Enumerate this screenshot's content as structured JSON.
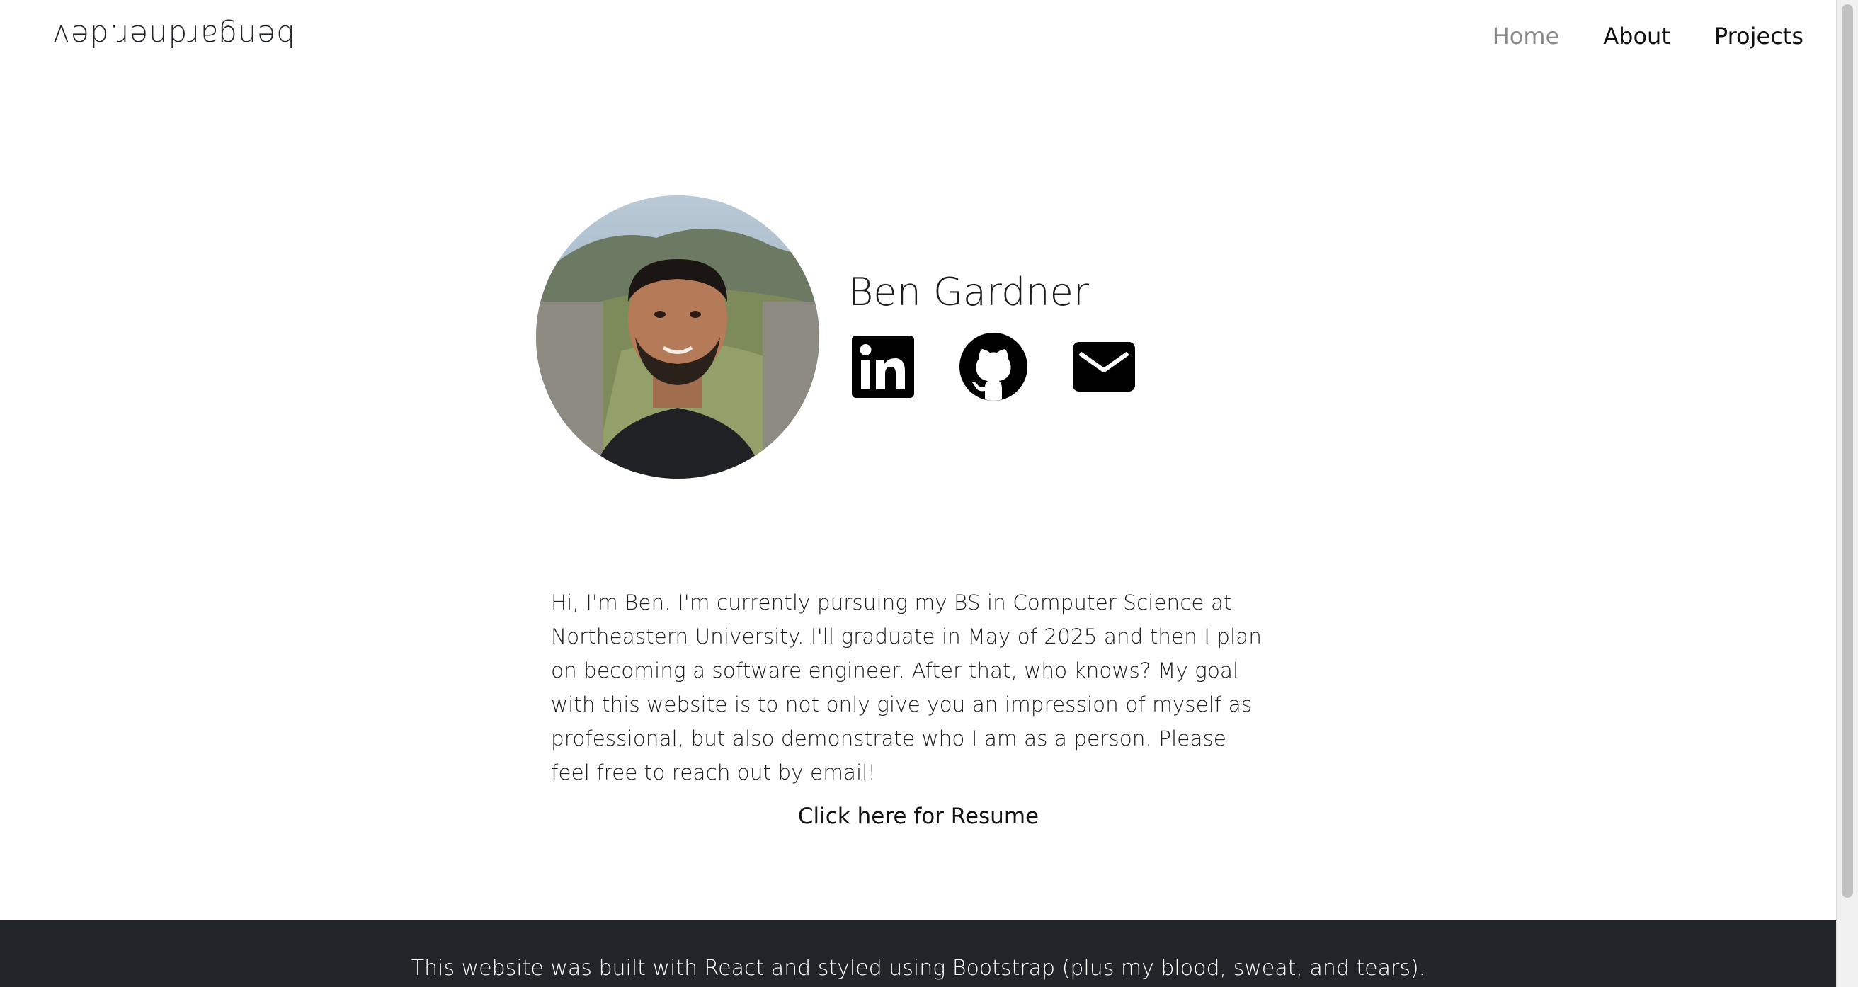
{
  "brand": {
    "text": "bengardner.dev"
  },
  "nav": {
    "items": [
      {
        "label": "Home",
        "active": true
      },
      {
        "label": "About",
        "active": false
      },
      {
        "label": "Projects",
        "active": false
      }
    ]
  },
  "profile": {
    "name": "Ben Gardner",
    "social": [
      {
        "icon": "linkedin-icon"
      },
      {
        "icon": "github-icon"
      },
      {
        "icon": "mail-icon"
      }
    ]
  },
  "bio": {
    "text": "Hi, I'm Ben. I'm currently pursuing my BS in Computer Science at Northeastern University. I'll graduate in May of 2025 and then I plan on becoming a software engineer. After that, who knows? My goal with this website is to not only give you an impression of myself as professional, but also demonstrate who I am as a person. Please feel free to reach out by email!"
  },
  "resume": {
    "label": "Click here for Resume"
  },
  "footer": {
    "text": "This website was built with React and styled using Bootstrap (plus my blood, sweat, and tears)."
  },
  "colors": {
    "footer_bg": "#212529",
    "active_nav": "#8a8a8a",
    "text": "#1d1d1d"
  }
}
